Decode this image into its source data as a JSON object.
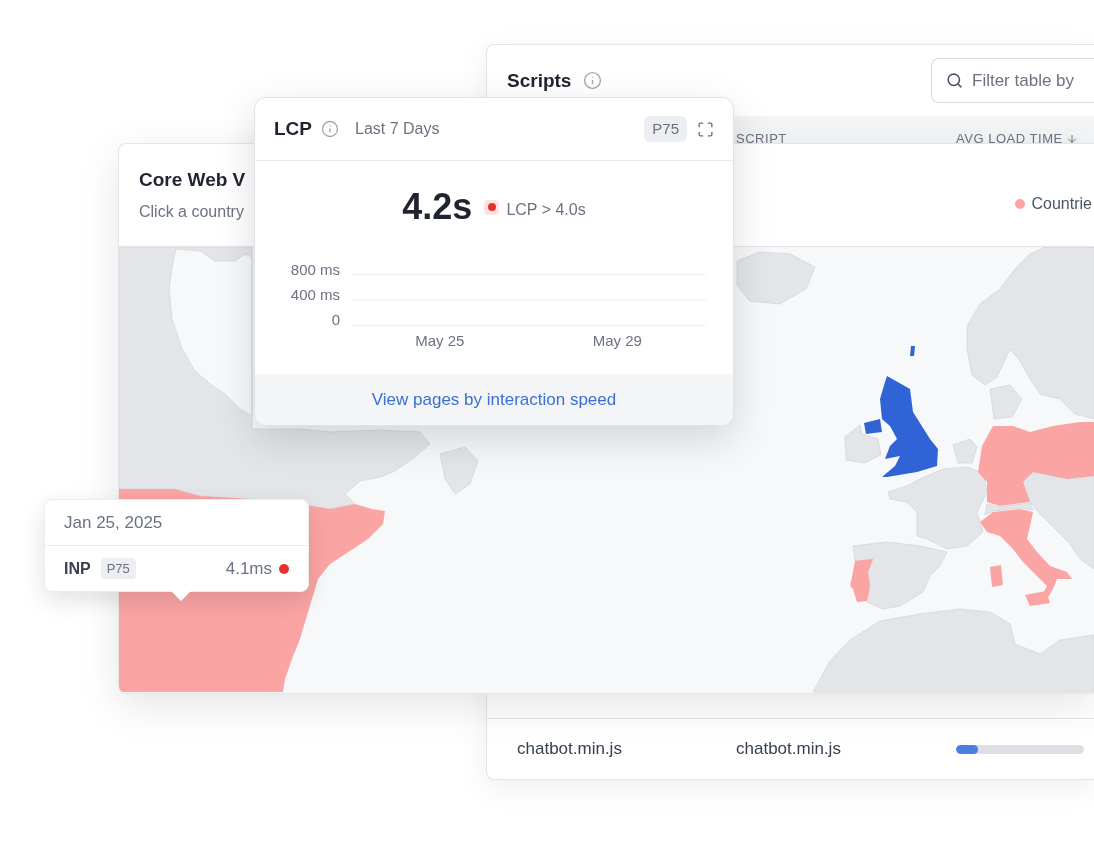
{
  "scripts_panel": {
    "title": "Scripts",
    "search": {
      "placeholder": "Filter table by"
    },
    "columns": [
      {
        "label": "SCRIPT",
        "sorted": false
      },
      {
        "label": "AVG LOAD TIME",
        "sorted": true
      }
    ],
    "rows": [
      {
        "column_1": "chatbot.min.js",
        "script": "chatbot.min.js",
        "level": 0.17
      }
    ]
  },
  "lcp_card": {
    "title": "LCP",
    "period": "Last 7 Days",
    "badge": "P75",
    "value": "4.2s",
    "alert": true,
    "threshold": "LCP > 4.0s",
    "chart_data": {
      "type": "line",
      "categories": [
        "May 25",
        "May 29"
      ],
      "ylim": [
        0,
        800
      ],
      "yticks": [
        {
          "value": 800,
          "label": "800 ms"
        },
        {
          "value": 400,
          "label": "400 ms"
        },
        0
      ]
    },
    "link": "View pages by interaction speed"
  },
  "vitals_card": {
    "title": "Core Web V",
    "subtitle": "Click a country",
    "legend": [
      {
        "label": "Countrie",
        "color": "#fba4a4"
      }
    ]
  },
  "tooltip": {
    "date": "Jan 25, 2025",
    "metric": "INP",
    "badge": "P75",
    "value": "4.1ms",
    "alert": true
  }
}
